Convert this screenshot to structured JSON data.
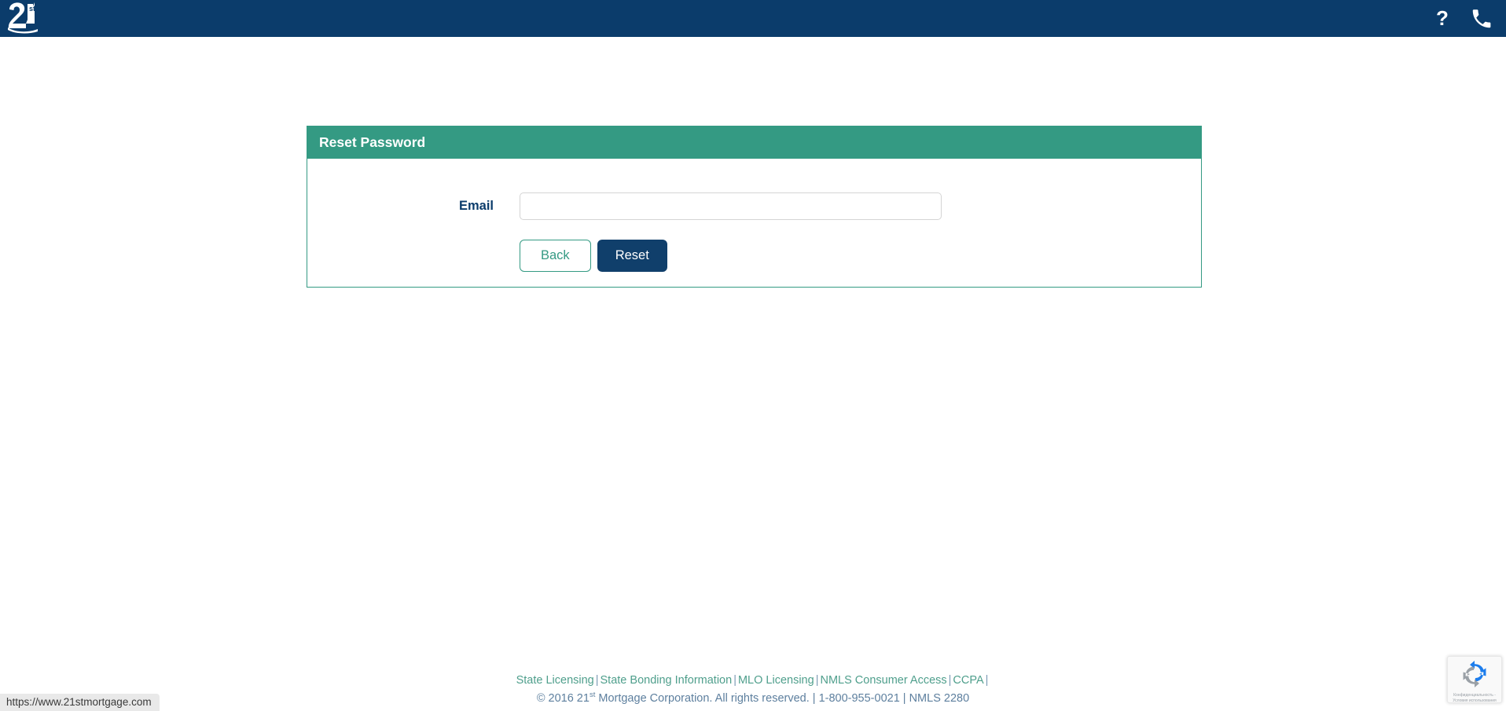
{
  "header": {
    "brand_logo_name": "21st-mortgage-logo",
    "brand_logo_text": "21st",
    "icons": [
      {
        "name": "help-question-icon",
        "glyph": "?"
      },
      {
        "name": "phone-icon",
        "glyph": "✆"
      }
    ],
    "background_color": "#0b3c6b"
  },
  "card": {
    "title": "Reset Password",
    "header_color": "#349a83",
    "form": {
      "email_label": "Email",
      "email_value": "",
      "email_placeholder": ""
    },
    "buttons": {
      "back_label": "Back",
      "reset_label": "Reset",
      "back_color": "#349a83",
      "reset_color": "#103f6b"
    }
  },
  "footer": {
    "links": [
      "State Licensing",
      "State Bonding Information",
      "MLO Licensing",
      "NMLS Consumer Access",
      "CCPA"
    ],
    "links_line": "State Licensing | State Bonding Information | MLO Licensing | NMLS Consumer Access | CCPA |",
    "copyright_prefix": "© 2016 21",
    "copyright_sup": "st",
    "copyright_suffix": " Mortgage Corporation. All rights reserved. | 1-800-955-0021 | NMLS 2280",
    "link_color": "#4f9f8c",
    "copy_color": "#5d7f9e"
  },
  "recaptcha": {
    "name": "recaptcha-badge",
    "privacy_text": "Конфиденциальность - Условия использования"
  },
  "status_bar": {
    "url": "https://www.21stmortgage.com"
  }
}
